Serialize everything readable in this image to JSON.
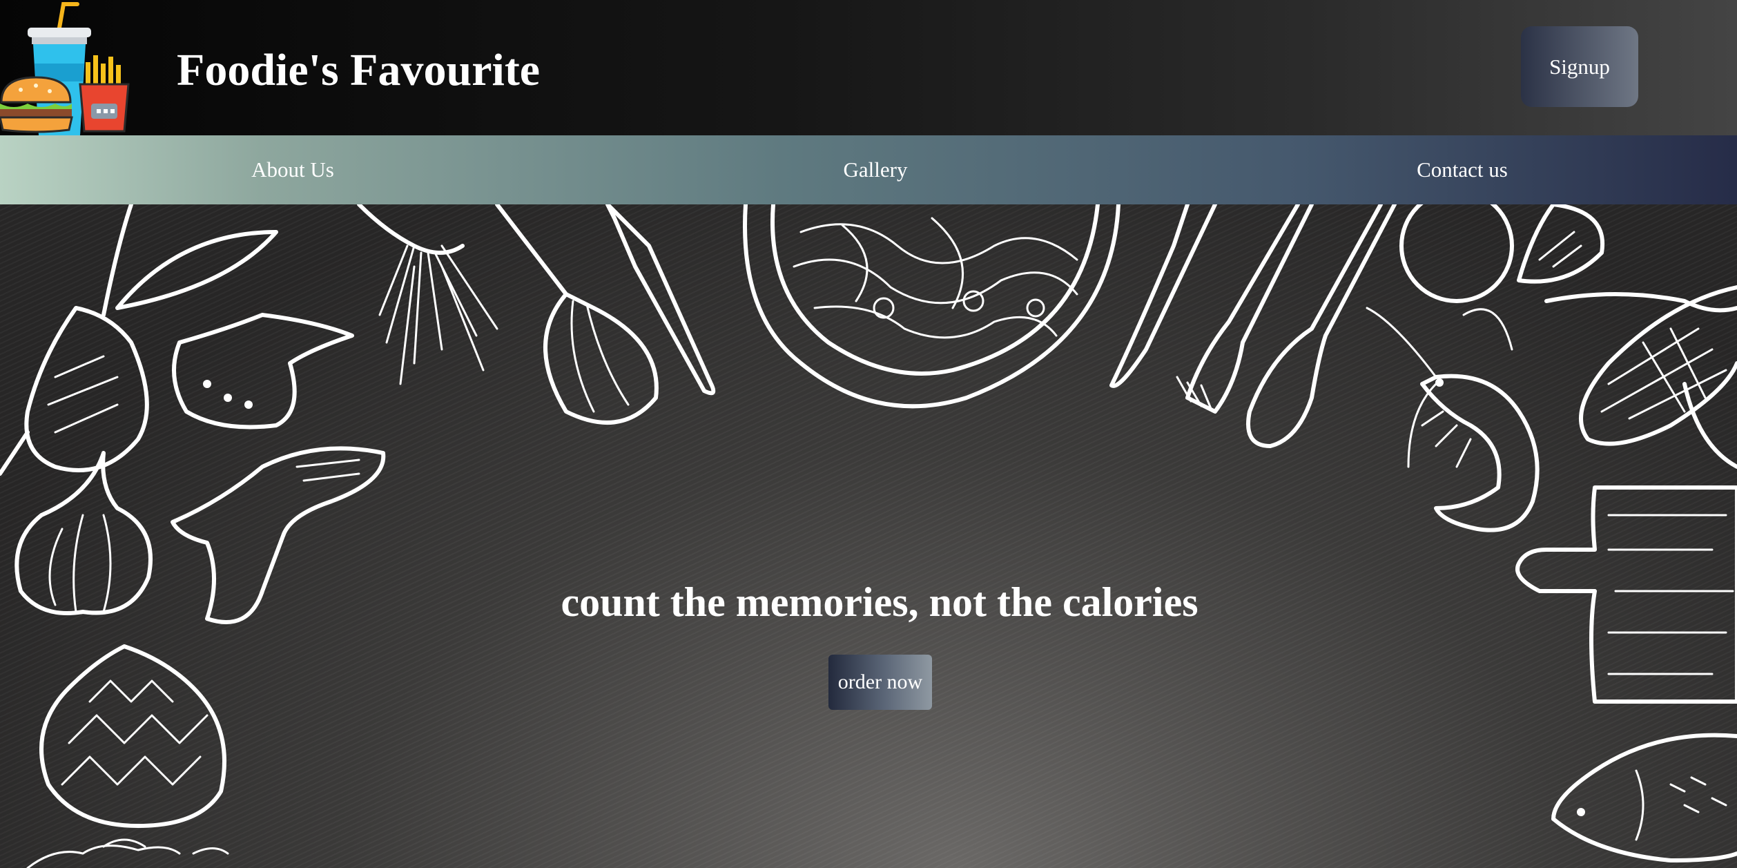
{
  "header": {
    "logo_icon": "fast-food-logo-icon",
    "title": "Foodie's Favourite",
    "signup_label": "Signup"
  },
  "nav": {
    "items": [
      {
        "label": "About Us"
      },
      {
        "label": "Gallery"
      },
      {
        "label": "Contact us"
      }
    ]
  },
  "hero": {
    "tagline": "count the memories, not the calories",
    "order_label": "order now",
    "background_icons": [
      "beetroot-icon",
      "chicken-wing-icon",
      "garlic-icon",
      "banana-icon",
      "artichoke-icon",
      "herb-root-icon",
      "whisk-icon",
      "knife-icon",
      "pasta-plate-icon",
      "fork-icon",
      "spoon-icon",
      "lemon-icon",
      "shrimp-icon",
      "corn-icon",
      "cutting-board-icon",
      "fish-icon"
    ]
  },
  "colors": {
    "header_bg": "#111111",
    "nav_gradient_start": "#b9d2c3",
    "nav_gradient_end": "#262c48",
    "button_gradient_start": "#2b3246",
    "button_gradient_end": "#6f7785",
    "text": "#ffffff"
  }
}
